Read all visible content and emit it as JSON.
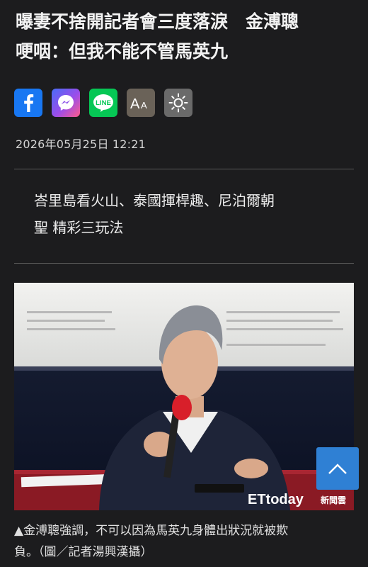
{
  "article": {
    "headline_line1": "曝妻不捨開記者會三度落淚　金溥聰",
    "headline_line2": "哽咽：但我不能不管馬英九",
    "timestamp": "2026年05月25日 12:21"
  },
  "share": {
    "facebook_icon": "facebook-icon",
    "messenger_icon": "messenger-icon",
    "line_label": "LINE",
    "font_size_label": "AA",
    "theme_icon": "sun-icon"
  },
  "ad": {
    "line1": "峇里島看火山、泰國揮桿趣、尼泊爾朝",
    "line2": "聖 精彩三玩法"
  },
  "photo": {
    "watermark_brand": "ETtoday",
    "watermark_sub": "新聞雲"
  },
  "caption": {
    "line1": "▲金溥聰強調，不可以因為馬英九身體出狀況就被欺",
    "line2": "負。（圖／記者湯興漢攝）"
  },
  "colors": {
    "background": "#1c1c1e",
    "facebook": "#1877f2",
    "line": "#06c755",
    "scroll_top": "#2f80d4"
  }
}
